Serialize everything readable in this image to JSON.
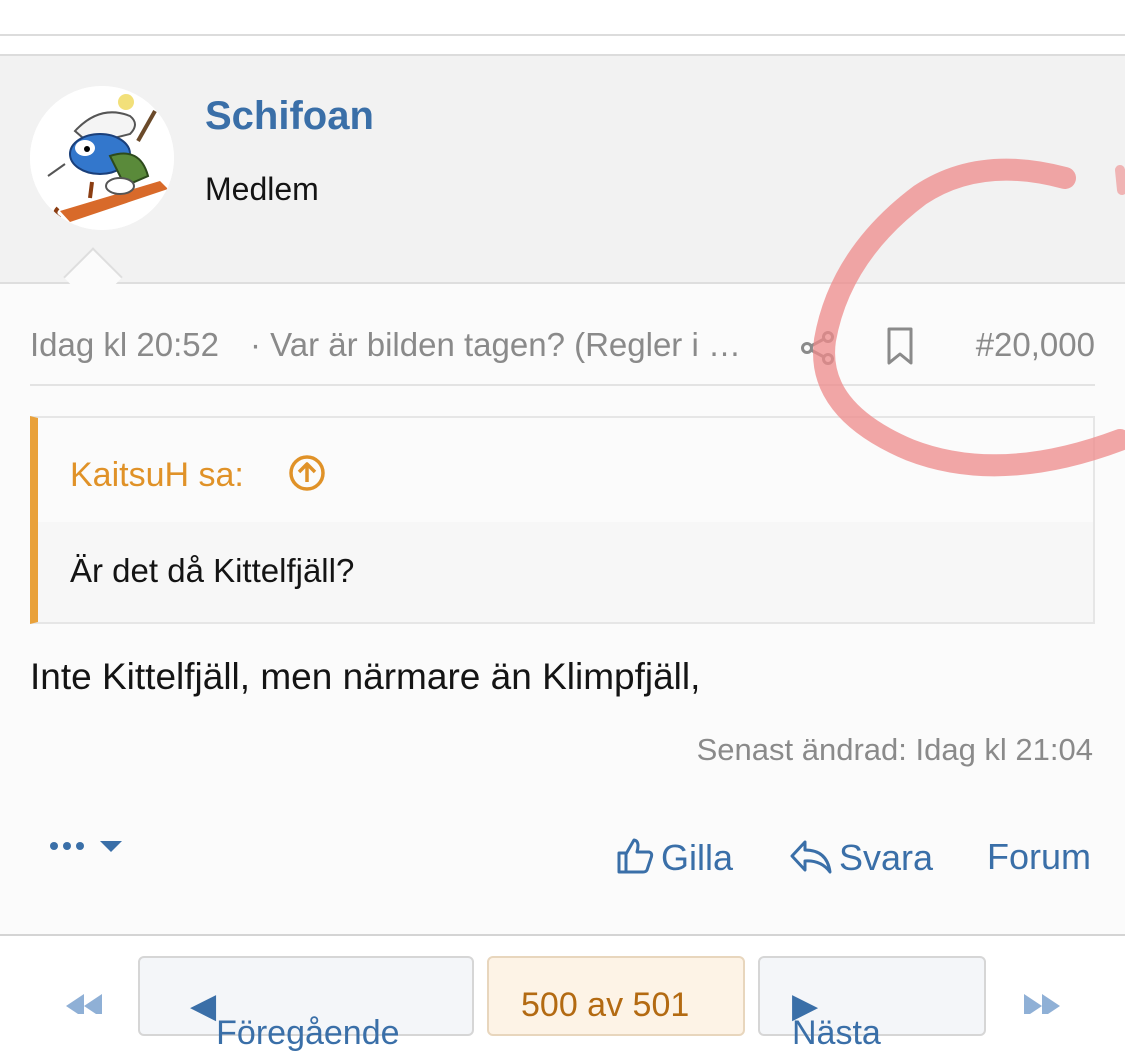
{
  "user": {
    "name": "Schifoan",
    "title": "Medlem"
  },
  "post": {
    "date": "Idag kl 20:52",
    "thread_title": "· Var är bilden tagen? (Regler i …",
    "number": "#20,000",
    "quote_author": "KaitsuH sa:",
    "quote_text": "Är det då Kittelfjäll?",
    "body": "Inte Kittelfjäll, men närmare än Klimpfjäll,",
    "edited": "Senast ändrad: Idag kl 21:04"
  },
  "actions": {
    "like": "Gilla",
    "reply": "Svara",
    "forum": "Forum"
  },
  "pager": {
    "prev": "Föregående",
    "current": "500 av 501",
    "next": "Nästa"
  },
  "colors": {
    "link": "#3a6fa8",
    "quote_accent": "#e9a13a",
    "annotation": "#ee8a8a"
  }
}
